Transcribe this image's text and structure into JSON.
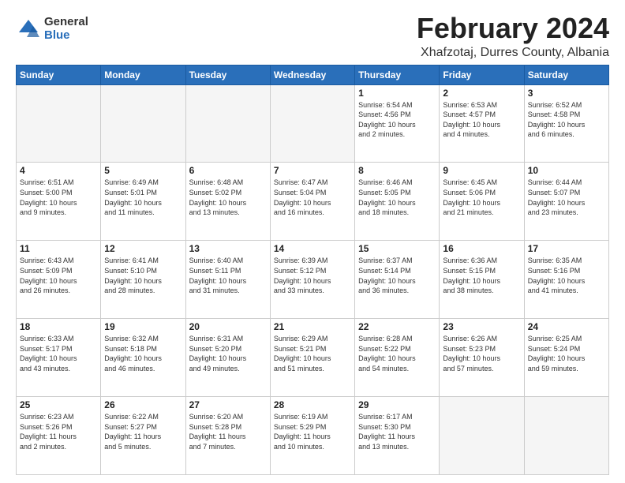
{
  "logo": {
    "general": "General",
    "blue": "Blue"
  },
  "title": "February 2024",
  "location": "Xhafzotaj, Durres County, Albania",
  "days_of_week": [
    "Sunday",
    "Monday",
    "Tuesday",
    "Wednesday",
    "Thursday",
    "Friday",
    "Saturday"
  ],
  "weeks": [
    [
      {
        "day": "",
        "info": ""
      },
      {
        "day": "",
        "info": ""
      },
      {
        "day": "",
        "info": ""
      },
      {
        "day": "",
        "info": ""
      },
      {
        "day": "1",
        "info": "Sunrise: 6:54 AM\nSunset: 4:56 PM\nDaylight: 10 hours\nand 2 minutes."
      },
      {
        "day": "2",
        "info": "Sunrise: 6:53 AM\nSunset: 4:57 PM\nDaylight: 10 hours\nand 4 minutes."
      },
      {
        "day": "3",
        "info": "Sunrise: 6:52 AM\nSunset: 4:58 PM\nDaylight: 10 hours\nand 6 minutes."
      }
    ],
    [
      {
        "day": "4",
        "info": "Sunrise: 6:51 AM\nSunset: 5:00 PM\nDaylight: 10 hours\nand 9 minutes."
      },
      {
        "day": "5",
        "info": "Sunrise: 6:49 AM\nSunset: 5:01 PM\nDaylight: 10 hours\nand 11 minutes."
      },
      {
        "day": "6",
        "info": "Sunrise: 6:48 AM\nSunset: 5:02 PM\nDaylight: 10 hours\nand 13 minutes."
      },
      {
        "day": "7",
        "info": "Sunrise: 6:47 AM\nSunset: 5:04 PM\nDaylight: 10 hours\nand 16 minutes."
      },
      {
        "day": "8",
        "info": "Sunrise: 6:46 AM\nSunset: 5:05 PM\nDaylight: 10 hours\nand 18 minutes."
      },
      {
        "day": "9",
        "info": "Sunrise: 6:45 AM\nSunset: 5:06 PM\nDaylight: 10 hours\nand 21 minutes."
      },
      {
        "day": "10",
        "info": "Sunrise: 6:44 AM\nSunset: 5:07 PM\nDaylight: 10 hours\nand 23 minutes."
      }
    ],
    [
      {
        "day": "11",
        "info": "Sunrise: 6:43 AM\nSunset: 5:09 PM\nDaylight: 10 hours\nand 26 minutes."
      },
      {
        "day": "12",
        "info": "Sunrise: 6:41 AM\nSunset: 5:10 PM\nDaylight: 10 hours\nand 28 minutes."
      },
      {
        "day": "13",
        "info": "Sunrise: 6:40 AM\nSunset: 5:11 PM\nDaylight: 10 hours\nand 31 minutes."
      },
      {
        "day": "14",
        "info": "Sunrise: 6:39 AM\nSunset: 5:12 PM\nDaylight: 10 hours\nand 33 minutes."
      },
      {
        "day": "15",
        "info": "Sunrise: 6:37 AM\nSunset: 5:14 PM\nDaylight: 10 hours\nand 36 minutes."
      },
      {
        "day": "16",
        "info": "Sunrise: 6:36 AM\nSunset: 5:15 PM\nDaylight: 10 hours\nand 38 minutes."
      },
      {
        "day": "17",
        "info": "Sunrise: 6:35 AM\nSunset: 5:16 PM\nDaylight: 10 hours\nand 41 minutes."
      }
    ],
    [
      {
        "day": "18",
        "info": "Sunrise: 6:33 AM\nSunset: 5:17 PM\nDaylight: 10 hours\nand 43 minutes."
      },
      {
        "day": "19",
        "info": "Sunrise: 6:32 AM\nSunset: 5:18 PM\nDaylight: 10 hours\nand 46 minutes."
      },
      {
        "day": "20",
        "info": "Sunrise: 6:31 AM\nSunset: 5:20 PM\nDaylight: 10 hours\nand 49 minutes."
      },
      {
        "day": "21",
        "info": "Sunrise: 6:29 AM\nSunset: 5:21 PM\nDaylight: 10 hours\nand 51 minutes."
      },
      {
        "day": "22",
        "info": "Sunrise: 6:28 AM\nSunset: 5:22 PM\nDaylight: 10 hours\nand 54 minutes."
      },
      {
        "day": "23",
        "info": "Sunrise: 6:26 AM\nSunset: 5:23 PM\nDaylight: 10 hours\nand 57 minutes."
      },
      {
        "day": "24",
        "info": "Sunrise: 6:25 AM\nSunset: 5:24 PM\nDaylight: 10 hours\nand 59 minutes."
      }
    ],
    [
      {
        "day": "25",
        "info": "Sunrise: 6:23 AM\nSunset: 5:26 PM\nDaylight: 11 hours\nand 2 minutes."
      },
      {
        "day": "26",
        "info": "Sunrise: 6:22 AM\nSunset: 5:27 PM\nDaylight: 11 hours\nand 5 minutes."
      },
      {
        "day": "27",
        "info": "Sunrise: 6:20 AM\nSunset: 5:28 PM\nDaylight: 11 hours\nand 7 minutes."
      },
      {
        "day": "28",
        "info": "Sunrise: 6:19 AM\nSunset: 5:29 PM\nDaylight: 11 hours\nand 10 minutes."
      },
      {
        "day": "29",
        "info": "Sunrise: 6:17 AM\nSunset: 5:30 PM\nDaylight: 11 hours\nand 13 minutes."
      },
      {
        "day": "",
        "info": ""
      },
      {
        "day": "",
        "info": ""
      }
    ]
  ]
}
